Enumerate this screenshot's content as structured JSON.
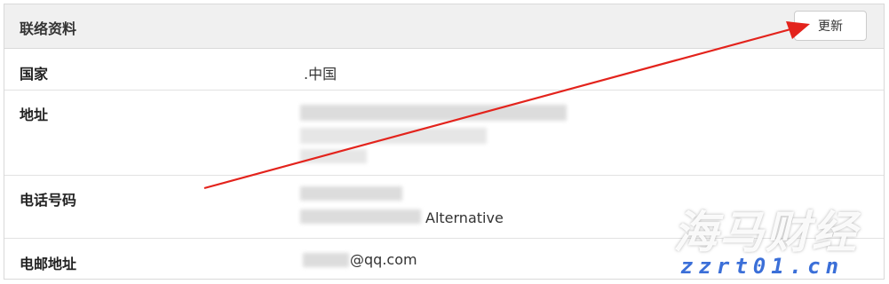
{
  "panel": {
    "title": "联络资料",
    "update_button": "更新"
  },
  "rows": {
    "country": {
      "label": "国家",
      "value": ".中国"
    },
    "address": {
      "label": "地址"
    },
    "phone": {
      "label": "电话号码",
      "alt_label": "Alternative"
    },
    "email": {
      "label": "电邮地址",
      "value": "@qq.com"
    }
  },
  "annotation": {
    "arrow_color": "#e3231c"
  },
  "watermark": {
    "text": "海马财经",
    "url": "zzrt01.cn"
  }
}
